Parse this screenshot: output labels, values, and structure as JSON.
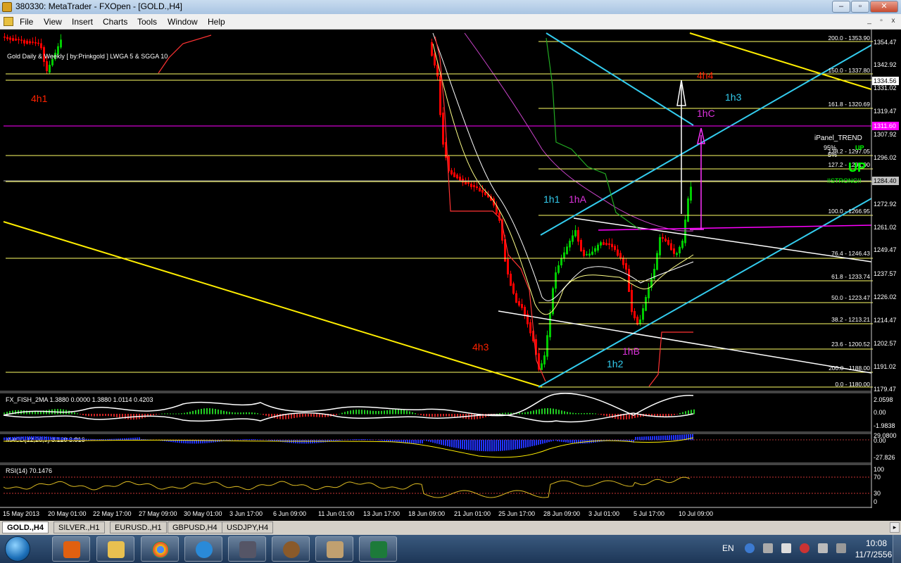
{
  "window": {
    "title": "380330: MetaTrader - FXOpen - [GOLD.,H4]",
    "buttons": [
      "–",
      "▫",
      "✕"
    ]
  },
  "menu": {
    "items": [
      "File",
      "View",
      "Insert",
      "Charts",
      "Tools",
      "Window",
      "Help"
    ],
    "mdi_buttons": [
      "_",
      "▫",
      "x"
    ]
  },
  "chart": {
    "header": "Gold Daily & Weekly [ by:Prinkgold ] LWGA 5  &  SGGA 10",
    "price_ticks": [
      "1354.47",
      "1342.92",
      "1331.02",
      "1319.47",
      "1307.92",
      "1296.02",
      "1284.40",
      "1272.92",
      "1261.02",
      "1249.47",
      "1237.57",
      "1226.02",
      "1214.47",
      "1202.57",
      "1191.02",
      "1179.47"
    ],
    "price_tag_white": "1334.56",
    "price_tag_magenta": "1311.60",
    "fib_levels": [
      {
        "label": "200.0 - 1353.90"
      },
      {
        "label": "150.0 - 1337.80"
      },
      {
        "label": "161.8 - 1320.69"
      },
      {
        "label": "138.2 - 1297.05"
      },
      {
        "label": "127.2 - 1291.90"
      },
      {
        "label": "100.0 - 1266.95"
      },
      {
        "label": "76.4 - 1246.43"
      },
      {
        "label": "61.8 - 1233.74"
      },
      {
        "label": "50.0 - 1223.47"
      },
      {
        "label": "38.2 - 1213.21"
      },
      {
        "label": "23.6 - 1200.52"
      },
      {
        "label": "200.0 - 1188.00"
      },
      {
        "label": "0.0 - 1180.00"
      }
    ],
    "wave_labels": [
      "4h1",
      "4h3",
      "4h4",
      "1h1",
      "1hA",
      "1h2",
      "1hB",
      "1h3",
      "1hC"
    ],
    "ipanel": {
      "title": "iPanel_TREND",
      "pct1": "95%",
      "up_small": "UP",
      "pct2": "5%",
      "up_big": "UP",
      "strong": "!!STRONG!!"
    },
    "fisher": {
      "header": "FX_FISH_2MA 1.3880 0.0000 1.3880 1.0114 0.4203",
      "ticks": [
        "2.0598",
        "0.00",
        "-1.9838"
      ]
    },
    "macd": {
      "header": "MACD(12,26,9) 8.120 3.816",
      "ticks": [
        "29.0800",
        "0.00",
        "-27.826"
      ]
    },
    "rsi": {
      "header": "RSI(14) 70.1476",
      "ticks": [
        "100",
        "70",
        "30",
        "0"
      ]
    },
    "time_labels": [
      "15 May 2013",
      "20 May 01:00",
      "22 May 17:00",
      "27 May 09:00",
      "30 May 01:00",
      "3 Jun 17:00",
      "6 Jun 09:00",
      "11 Jun 01:00",
      "13 Jun 17:00",
      "18 Jun 09:00",
      "21 Jun 01:00",
      "25 Jun 17:00",
      "28 Jun 09:00",
      "3 Jul 01:00",
      "5 Jul 17:00",
      "10 Jul 09:00"
    ]
  },
  "tabs": [
    "GOLD.,H4",
    "SILVER.,H1",
    "EURUSD.,H1",
    "GBPUSD,H4",
    "USDJPY,H4"
  ],
  "taskbar": {
    "lang": "EN",
    "time": "10:08",
    "date": "11/7/2556"
  },
  "colors": {
    "bear": "#ff0000",
    "bull": "#00cc00",
    "fib": "#ffff66",
    "trend_yellow": "#ffee00",
    "channel": "#33ccee",
    "magenta": "#ff00ff",
    "wave_red": "#ff2200",
    "wave_cyan": "#33ccee",
    "wave_magenta": "#dd33dd"
  }
}
